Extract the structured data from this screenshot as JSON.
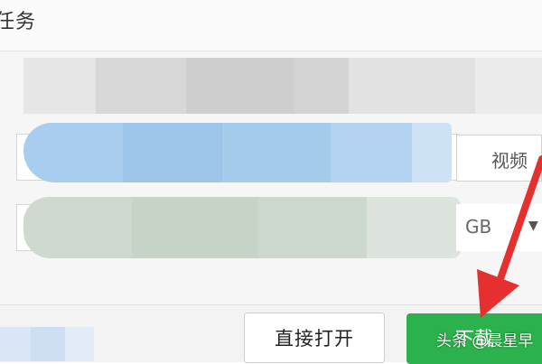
{
  "window": {
    "title": "任务"
  },
  "form": {
    "type_select": {
      "value": "视频"
    },
    "size_select": {
      "value": "GB"
    }
  },
  "footer": {
    "open_button_label": "直接打开",
    "download_button_label": "下载"
  },
  "watermark": {
    "text": "头条 @晨星早"
  },
  "colors": {
    "download_green": "#2bb24c",
    "annotation_arrow_red": "#e63030"
  },
  "icons": [
    "dropdown-caret-icon",
    "annotation-arrow-icon"
  ]
}
